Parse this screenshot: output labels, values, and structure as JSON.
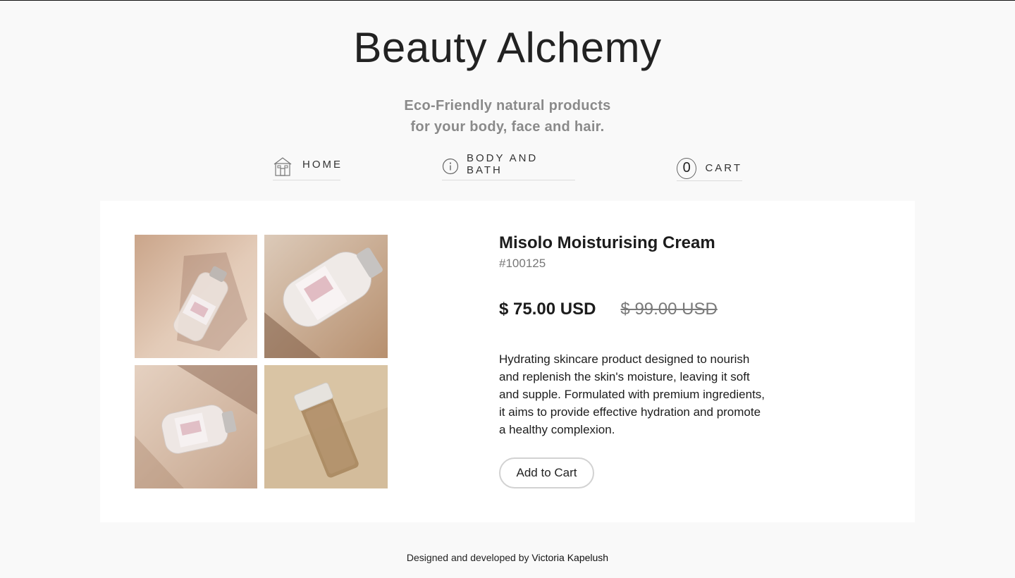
{
  "header": {
    "title": "Beauty Alchemy",
    "tagline_line1": "Eco-Friendly natural products",
    "tagline_line2": "for your body, face and hair."
  },
  "nav": {
    "home": {
      "label": "HOME",
      "icon": "house-icon"
    },
    "body_and_bath": {
      "label": "BODY AND BATH",
      "icon": "info-icon"
    },
    "cart": {
      "label": "CART",
      "count": "0"
    }
  },
  "product": {
    "name": "Misolo Moisturising Cream",
    "sku": "#100125",
    "price": "$ 75.00 USD",
    "old_price": "$ 99.00 USD",
    "description": "Hydrating skincare product designed to nourish and replenish the skin's moisture, leaving it soft and supple. Formulated with premium ingredients, it aims to provide effective hydration and promote a healthy complexion.",
    "add_to_cart_label": "Add to Cart",
    "images": [
      {
        "icon": "product-photo-bottle-tilted"
      },
      {
        "icon": "product-photo-bottle-closeup"
      },
      {
        "icon": "product-photo-bottle-floating"
      },
      {
        "icon": "product-photo-bottle-amber"
      }
    ]
  },
  "footer": {
    "credit_prefix": "Designed and developed by",
    "author": "Victoria Kapelush"
  },
  "colors": {
    "background": "#f9f9f9",
    "card": "#ffffff",
    "muted_text": "#8a8a8a",
    "text": "#1c1c1c"
  }
}
